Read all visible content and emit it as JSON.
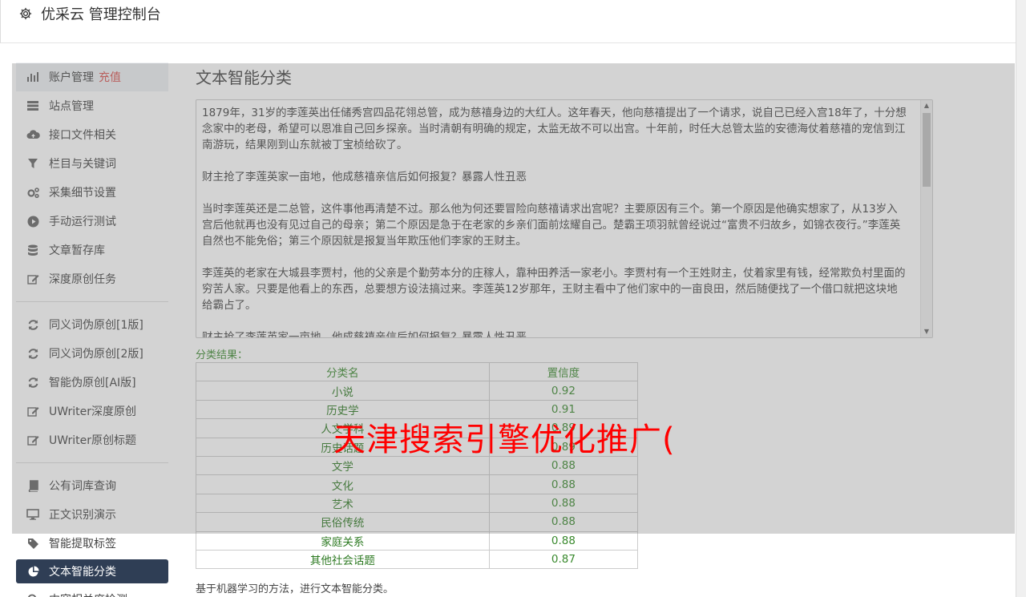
{
  "app": {
    "title": "优采云 管理控制台"
  },
  "sidebar": {
    "group1": [
      {
        "icon": "bar-chart-icon",
        "label": "账户管理",
        "extra": "充值"
      },
      {
        "icon": "server-icon",
        "label": "站点管理"
      },
      {
        "icon": "cloud-upload-icon",
        "label": "接口文件相关"
      },
      {
        "icon": "filter-icon",
        "label": "栏目与关键词"
      },
      {
        "icon": "gears-icon",
        "label": "采集细节设置"
      },
      {
        "icon": "play-circle-icon",
        "label": "手动运行测试"
      },
      {
        "icon": "database-icon",
        "label": "文章暂存库"
      },
      {
        "icon": "edit-icon",
        "label": "深度原创任务"
      }
    ],
    "group2": [
      {
        "icon": "refresh-icon",
        "label": "同义词伪原创[1版]"
      },
      {
        "icon": "refresh-icon",
        "label": "同义词伪原创[2版]"
      },
      {
        "icon": "refresh-icon",
        "label": "智能伪原创[AI版]"
      },
      {
        "icon": "edit-icon",
        "label": "UWriter深度原创"
      },
      {
        "icon": "edit-icon",
        "label": "UWriter原创标题"
      }
    ],
    "group3": [
      {
        "icon": "book-icon",
        "label": "公有词库查询"
      },
      {
        "icon": "monitor-icon",
        "label": "正文识别演示"
      },
      {
        "icon": "tag-icon",
        "label": "智能提取标签"
      },
      {
        "icon": "pie-chart-icon",
        "label": "文本智能分类",
        "active": true
      },
      {
        "icon": "search-icon",
        "label": "内容相关度检测"
      }
    ]
  },
  "main": {
    "title": "文本智能分类",
    "text_paragraphs": [
      "1879年，31岁的李莲英出任储秀宫四品花翎总管，成为慈禧身边的大红人。这年春天，他向慈禧提出了一个请求，说自己已经入宫18年了，十分想念家中的老母，希望可以恩准自己回乡探亲。当时清朝有明确的规定，太监无故不可以出宫。十年前，时任大总管太监的安德海仗着慈禧的宠信到江南游玩，结果刚到山东就被丁宝桢给砍了。",
      "财主抢了李莲英家一亩地，他成慈禧亲信后如何报复？暴露人性丑恶",
      "当时李莲英还是二总管，这件事他再清楚不过。那么他为何还要冒险向慈禧请求出宫呢？主要原因有三个。第一个原因是他确实想家了，从13岁入宫后他就再也没有见过自己的母亲；第二个原因是急于在老家的乡亲们面前炫耀自己。楚霸王项羽就曾经说过“富贵不归故乡，如锦衣夜行。”李莲英自然也不能免俗；第三个原因就是报复当年欺压他们李家的王财主。",
      "李莲英的老家在大城县李贾村，他的父亲是个勤劳本分的庄稼人，靠种田养活一家老小。李贾村有一个王姓财主，仗着家里有钱，经常欺负村里面的穷苦人家。只要是他看上的东西，总要想方设法搞过来。李莲英12岁那年，王财主看中了他们家中的一亩良田，然后随便找了一个借口就把这块地给霸占了。",
      "财主抢了李莲英家一亩地，他成慈禧亲信后如何报复？暴露人性丑恶"
    ],
    "result_label": "分类结果：",
    "table": {
      "headers": [
        "分类名",
        "置信度"
      ],
      "rows": [
        [
          "小说",
          "0.92"
        ],
        [
          "历史学",
          "0.91"
        ],
        [
          "人文学科",
          "0.89"
        ],
        [
          "历史话题",
          "0.89"
        ],
        [
          "文学",
          "0.88"
        ],
        [
          "文化",
          "0.88"
        ],
        [
          "艺术",
          "0.88"
        ],
        [
          "民俗传统",
          "0.88"
        ],
        [
          "家庭关系",
          "0.88"
        ],
        [
          "其他社会话题",
          "0.87"
        ]
      ]
    },
    "footnote": "基于机器学习的方法，进行文本智能分类。"
  },
  "watermark": "天津搜索引擎优化推广(",
  "colors": {
    "active_bg": "#2f3e55",
    "green": "#3a8a2e",
    "red": "#d9534f"
  }
}
